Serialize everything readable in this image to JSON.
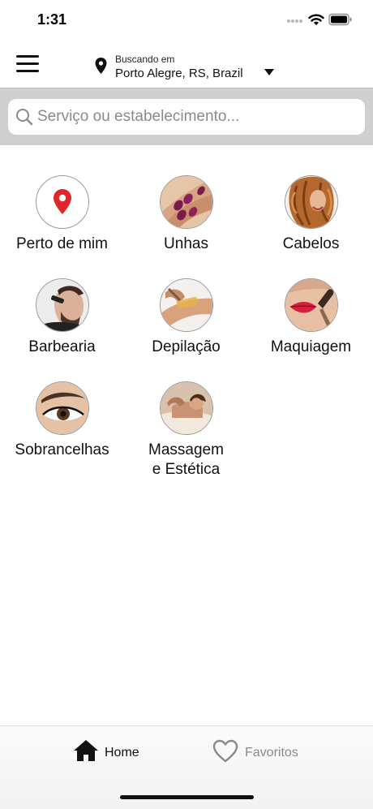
{
  "status_bar": {
    "time": "1:31"
  },
  "header": {
    "location_caption": "Buscando em",
    "location_value": "Porto Alegre, RS, Brazil"
  },
  "search": {
    "placeholder": "Serviço ou estabelecimento..."
  },
  "categories": [
    {
      "label": "Perto de mim",
      "icon": "location-pin-icon"
    },
    {
      "label": "Unhas",
      "icon": "nails-photo"
    },
    {
      "label": "Cabelos",
      "icon": "hair-photo"
    },
    {
      "label": "Barbearia",
      "icon": "barber-photo"
    },
    {
      "label": "Depilação",
      "icon": "waxing-photo"
    },
    {
      "label": "Maquiagem",
      "icon": "makeup-photo"
    },
    {
      "label": "Sobrancelhas",
      "icon": "eyebrow-photo"
    },
    {
      "label": "Massagem\ne Estética",
      "icon": "massage-photo"
    }
  ],
  "tabbar": {
    "home_label": "Home",
    "favorites_label": "Favoritos"
  },
  "colors": {
    "accent_pin": "#e0262b",
    "search_band": "#cfcfcf",
    "inactive_tab": "#8a8a8a"
  }
}
